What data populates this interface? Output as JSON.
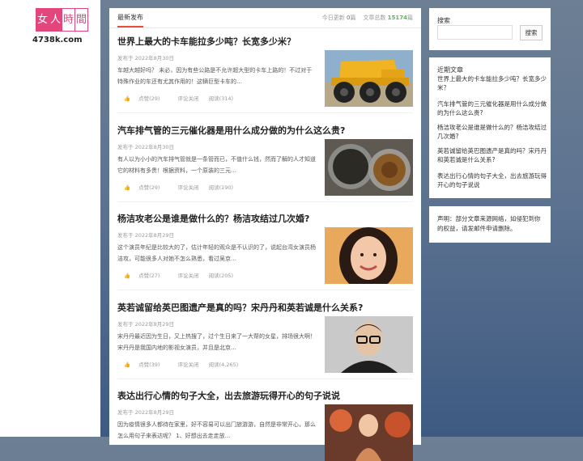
{
  "site": {
    "logo_chars": [
      "女",
      "人",
      "時",
      "間"
    ],
    "url": "4738k.com"
  },
  "tabs": {
    "active": "最新发布",
    "today_label": "今日更新",
    "today_count": "0",
    "today_unit": "篇",
    "total_label": "文章总数",
    "total_count": "15174",
    "total_unit": "篇"
  },
  "posts": [
    {
      "title": "世界上最大的卡车能拉多少吨？长宽多少米？",
      "meta": "发布于 2022年8月30日",
      "excerpt": "车越大越好吗？ 未必，因为有些公路是不允许超大型的卡车上路的！不过对于特殊作业的车还有尤其作用的！这辆巨型卡车的…",
      "likes": "点赞(29)",
      "comments": "评论关闭",
      "views": "阅读(314)",
      "thumb_icon": "mining-truck-image"
    },
    {
      "title": "汽车排气管的三元催化器是用什么成分做的为什么这么贵?",
      "meta": "发布于 2022年8月30日",
      "excerpt": "有人以为小小的汽车排气管就是一条管而已，不值什么钱，然而了解的人才知道它的材料有多贵！根据资料，一个原装的三元…",
      "likes": "点赞(29)",
      "comments": "评论关闭",
      "views": "阅读(190)",
      "thumb_icon": "exhaust-pipe-image"
    },
    {
      "title": "杨洁攻老公是谁是做什么的？杨洁攻结过几次婚?",
      "meta": "发布于 2022年8月29日",
      "excerpt": "这个演员年纪是比较大的了，估计年轻的观众是不认识的了，说起台湾女演员杨洁攻，可能很多人对她不怎么熟悉，看过吴京…",
      "likes": "点赞(27)",
      "comments": "评论关闭",
      "views": "阅读(205)",
      "thumb_icon": "actress-portrait-image"
    },
    {
      "title": "英若诚留给英巴图遗产是真的吗？宋丹丹和英若诚是什么关系?",
      "meta": "发布于 2022年8月29日",
      "excerpt": "宋丹丹最近因为生日，又上热搜了，过个生日来了一大帮的女星，排场很大啊！宋丹丹是我国内地的影视女演员，并且是北京…",
      "likes": "点赞(39)",
      "comments": "评论关闭",
      "views": "阅读(4,265)",
      "thumb_icon": "man-glasses-portrait-image"
    },
    {
      "title": "表达出行心情的句子大全，出去旅游玩得开心的句子说说",
      "meta": "发布于 2022年8月29日",
      "excerpt": "因为疫情很多人都待在家里，好不容易可以出门旅游游，自然是非常开心，那么怎么用句子来表达呢？ 1、好想出去走走放…",
      "likes": "",
      "comments": "",
      "views": "",
      "thumb_icon": "travel-photo-image"
    }
  ],
  "sidebar": {
    "search_title": "搜索",
    "search_button": "搜索",
    "search_placeholder": "",
    "recent_title": "近期文章",
    "recent": [
      "世界上最大的卡车能拉多少吨？长宽多少米？",
      "汽车排气管的三元催化器是用什么成分做的为什么这么贵?",
      "杨洁攻老公是谁是做什么的？杨洁攻结过几次婚?",
      "英若诚留给英巴图遗产是真的吗？宋丹丹和英若诚是什么关系?",
      "表达出行心情的句子大全，出去旅游玩得开心的句子说说"
    ],
    "notice": "声明：部分文章来源网络，如侵犯到你的权益，请发邮件申请删除。"
  },
  "colors": {
    "accent": "#e74c3c",
    "logo_pink": "#e3467d",
    "count_green": "#5cb85c"
  }
}
